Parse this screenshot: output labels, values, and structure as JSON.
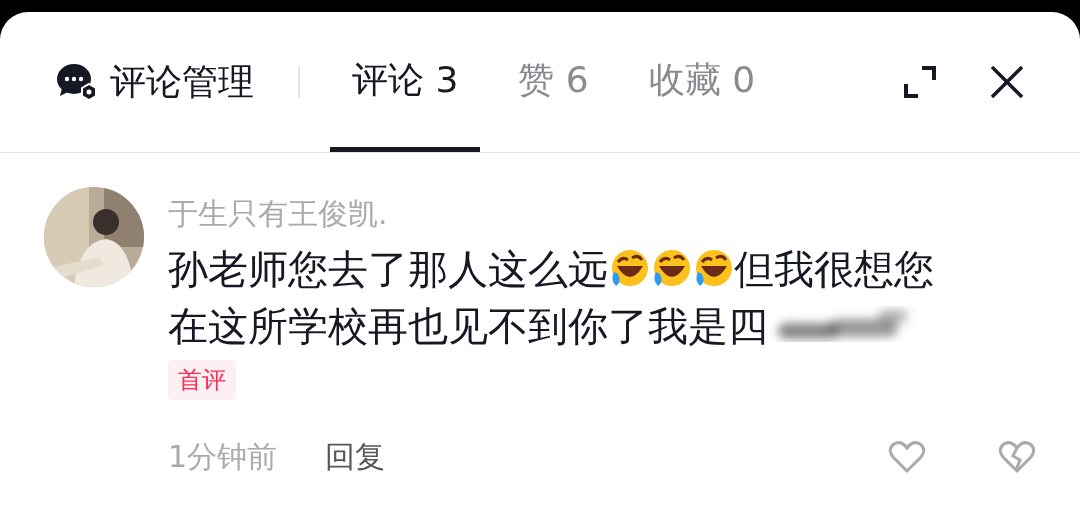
{
  "header": {
    "title": "评论管理"
  },
  "tabs": [
    {
      "label": "评论 3",
      "selected": true
    },
    {
      "label": "赞 6",
      "selected": false
    },
    {
      "label": "收藏 0",
      "selected": false
    }
  ],
  "comments": [
    {
      "author": "于生只有王俊凯.",
      "body": [
        {
          "kind": "text",
          "text": "孙老师您去了那人这么远"
        },
        {
          "kind": "emoji"
        },
        {
          "kind": "emoji"
        },
        {
          "kind": "emoji"
        },
        {
          "kind": "text",
          "text": "但我很想您"
        },
        {
          "kind": "break"
        },
        {
          "kind": "text",
          "text": "在这所学校再也见不到你了我是四"
        },
        {
          "kind": "blur"
        }
      ],
      "badge": "首评",
      "time": "1分钟前",
      "reply": "回复",
      "liked": false
    }
  ]
}
